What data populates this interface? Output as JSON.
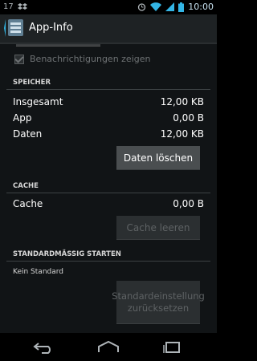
{
  "status_bar": {
    "notification_count": "17",
    "notification_icon": "dropbox-icon",
    "icons": [
      "alarm-icon",
      "wifi-icon",
      "signal-icon",
      "battery-icon"
    ],
    "time": "10:00"
  },
  "action_bar": {
    "icon": "settings-app-icon",
    "title": "App-Info"
  },
  "notifications": {
    "label": "Benachrichtigungen zeigen",
    "checked": true
  },
  "storage": {
    "header": "SPEICHER",
    "rows": [
      {
        "label": "Insgesamt",
        "value": "12,00 KB"
      },
      {
        "label": "App",
        "value": "0,00 B"
      },
      {
        "label": "Daten",
        "value": "12,00 KB"
      }
    ],
    "clear_data_button": "Daten löschen"
  },
  "cache": {
    "header": "CACHE",
    "row": {
      "label": "Cache",
      "value": "0,00 B"
    },
    "clear_cache_button": "Cache leeren"
  },
  "launch_default": {
    "header": "STANDARDMÄSSIG STARTEN",
    "status": "Kein Standard",
    "reset_button": "Standardeinstellung zurücksetzen"
  },
  "nav_bar": {
    "icons": [
      "back-icon",
      "home-icon",
      "recent-apps-icon"
    ]
  },
  "colors": {
    "accent": "#33b5e5",
    "background": "#111416"
  }
}
